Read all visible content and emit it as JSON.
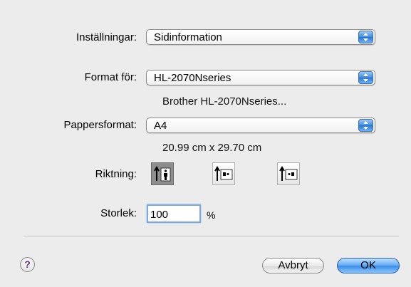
{
  "settings": {
    "label": "Inställningar:",
    "value": "Sidinformation"
  },
  "format_for": {
    "label": "Format för:",
    "value": "HL-2070Nseries",
    "description": "Brother HL-2070Nseries..."
  },
  "paper_size": {
    "label": "Pappersformat:",
    "value": "A4",
    "dimensions": "20.99 cm x 29.70 cm"
  },
  "orientation": {
    "label": "Riktning:",
    "options": [
      "portrait",
      "landscape",
      "landscape-reversed"
    ],
    "selected": "portrait"
  },
  "scale": {
    "label": "Storlek:",
    "value": "100",
    "unit": "%"
  },
  "buttons": {
    "help": "?",
    "cancel": "Avbryt",
    "ok": "OK"
  },
  "colors": {
    "accent": "#3b8ee8",
    "selected_orientation": "#8d8d8d",
    "background": "#ececec"
  }
}
